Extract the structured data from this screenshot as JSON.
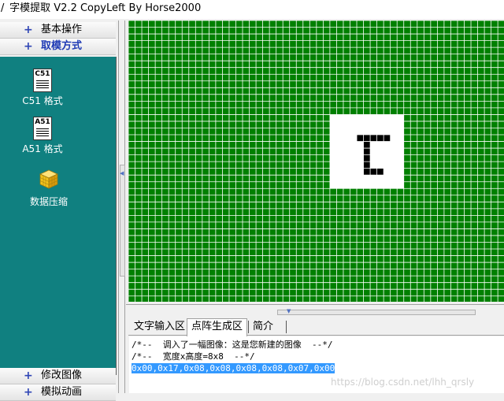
{
  "window": {
    "title": "字模提取 V2.2  CopyLeft By Horse2000"
  },
  "sidebar": {
    "top_items": [
      {
        "label": "基本操作"
      },
      {
        "label": "取模方式"
      }
    ],
    "tools": [
      {
        "icon_text": "C51",
        "label": "C51 格式"
      },
      {
        "icon_text": "A51",
        "label": "A51 格式"
      },
      {
        "label": "数据压缩"
      }
    ],
    "bottom_items": [
      {
        "label": "修改图像"
      },
      {
        "label": "模拟动画"
      }
    ]
  },
  "editor": {
    "grid_color": "#008000",
    "grid_line_color": "#ffffff",
    "pixel_on_color": "#000000",
    "image_bg_color": "#ffffff",
    "glyph_rows": [
      "00000000",
      "00111110",
      "00010000",
      "00010000",
      "00010000",
      "00010000",
      "00011100",
      "00000000"
    ]
  },
  "tabs": [
    {
      "label": "文字输入区"
    },
    {
      "label": "点阵生成区"
    },
    {
      "label": "简介"
    }
  ],
  "output": {
    "line1": "/*--  调入了一幅图像：这是您新建的图像  --*/",
    "line2": "/*--  宽度x高度=8x8  --*/",
    "line3": "0x00,0x17,0x08,0x08,0x08,0x08,0x07,0x00"
  },
  "watermark": "https://blog.csdn.net/lhh_qrsly"
}
